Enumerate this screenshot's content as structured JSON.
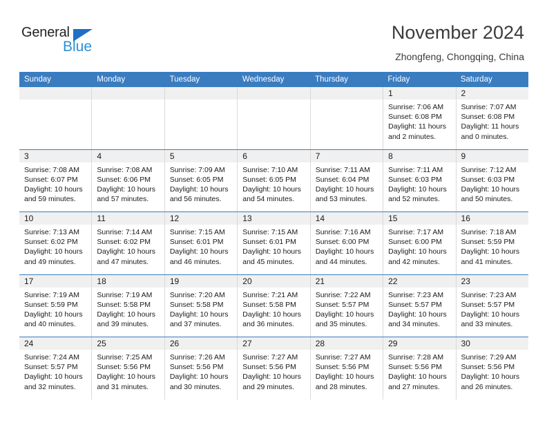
{
  "brand": {
    "name_part1": "General",
    "name_part2": "Blue",
    "accent_color": "#2d8ed6",
    "triangle_color": "#1f6fc4"
  },
  "header": {
    "title": "November 2024",
    "subtitle": "Zhongfeng, Chongqing, China"
  },
  "calendar": {
    "header_color": "#3a7cc0",
    "weekdays": [
      "Sunday",
      "Monday",
      "Tuesday",
      "Wednesday",
      "Thursday",
      "Friday",
      "Saturday"
    ],
    "weeks": [
      [
        {
          "date": "",
          "sunrise": "",
          "sunset": "",
          "daylight_line1": "",
          "daylight_line2": ""
        },
        {
          "date": "",
          "sunrise": "",
          "sunset": "",
          "daylight_line1": "",
          "daylight_line2": ""
        },
        {
          "date": "",
          "sunrise": "",
          "sunset": "",
          "daylight_line1": "",
          "daylight_line2": ""
        },
        {
          "date": "",
          "sunrise": "",
          "sunset": "",
          "daylight_line1": "",
          "daylight_line2": ""
        },
        {
          "date": "",
          "sunrise": "",
          "sunset": "",
          "daylight_line1": "",
          "daylight_line2": ""
        },
        {
          "date": "1",
          "sunrise": "Sunrise: 7:06 AM",
          "sunset": "Sunset: 6:08 PM",
          "daylight_line1": "Daylight: 11 hours",
          "daylight_line2": "and 2 minutes."
        },
        {
          "date": "2",
          "sunrise": "Sunrise: 7:07 AM",
          "sunset": "Sunset: 6:08 PM",
          "daylight_line1": "Daylight: 11 hours",
          "daylight_line2": "and 0 minutes."
        }
      ],
      [
        {
          "date": "3",
          "sunrise": "Sunrise: 7:08 AM",
          "sunset": "Sunset: 6:07 PM",
          "daylight_line1": "Daylight: 10 hours",
          "daylight_line2": "and 59 minutes."
        },
        {
          "date": "4",
          "sunrise": "Sunrise: 7:08 AM",
          "sunset": "Sunset: 6:06 PM",
          "daylight_line1": "Daylight: 10 hours",
          "daylight_line2": "and 57 minutes."
        },
        {
          "date": "5",
          "sunrise": "Sunrise: 7:09 AM",
          "sunset": "Sunset: 6:05 PM",
          "daylight_line1": "Daylight: 10 hours",
          "daylight_line2": "and 56 minutes."
        },
        {
          "date": "6",
          "sunrise": "Sunrise: 7:10 AM",
          "sunset": "Sunset: 6:05 PM",
          "daylight_line1": "Daylight: 10 hours",
          "daylight_line2": "and 54 minutes."
        },
        {
          "date": "7",
          "sunrise": "Sunrise: 7:11 AM",
          "sunset": "Sunset: 6:04 PM",
          "daylight_line1": "Daylight: 10 hours",
          "daylight_line2": "and 53 minutes."
        },
        {
          "date": "8",
          "sunrise": "Sunrise: 7:11 AM",
          "sunset": "Sunset: 6:03 PM",
          "daylight_line1": "Daylight: 10 hours",
          "daylight_line2": "and 52 minutes."
        },
        {
          "date": "9",
          "sunrise": "Sunrise: 7:12 AM",
          "sunset": "Sunset: 6:03 PM",
          "daylight_line1": "Daylight: 10 hours",
          "daylight_line2": "and 50 minutes."
        }
      ],
      [
        {
          "date": "10",
          "sunrise": "Sunrise: 7:13 AM",
          "sunset": "Sunset: 6:02 PM",
          "daylight_line1": "Daylight: 10 hours",
          "daylight_line2": "and 49 minutes."
        },
        {
          "date": "11",
          "sunrise": "Sunrise: 7:14 AM",
          "sunset": "Sunset: 6:02 PM",
          "daylight_line1": "Daylight: 10 hours",
          "daylight_line2": "and 47 minutes."
        },
        {
          "date": "12",
          "sunrise": "Sunrise: 7:15 AM",
          "sunset": "Sunset: 6:01 PM",
          "daylight_line1": "Daylight: 10 hours",
          "daylight_line2": "and 46 minutes."
        },
        {
          "date": "13",
          "sunrise": "Sunrise: 7:15 AM",
          "sunset": "Sunset: 6:01 PM",
          "daylight_line1": "Daylight: 10 hours",
          "daylight_line2": "and 45 minutes."
        },
        {
          "date": "14",
          "sunrise": "Sunrise: 7:16 AM",
          "sunset": "Sunset: 6:00 PM",
          "daylight_line1": "Daylight: 10 hours",
          "daylight_line2": "and 44 minutes."
        },
        {
          "date": "15",
          "sunrise": "Sunrise: 7:17 AM",
          "sunset": "Sunset: 6:00 PM",
          "daylight_line1": "Daylight: 10 hours",
          "daylight_line2": "and 42 minutes."
        },
        {
          "date": "16",
          "sunrise": "Sunrise: 7:18 AM",
          "sunset": "Sunset: 5:59 PM",
          "daylight_line1": "Daylight: 10 hours",
          "daylight_line2": "and 41 minutes."
        }
      ],
      [
        {
          "date": "17",
          "sunrise": "Sunrise: 7:19 AM",
          "sunset": "Sunset: 5:59 PM",
          "daylight_line1": "Daylight: 10 hours",
          "daylight_line2": "and 40 minutes."
        },
        {
          "date": "18",
          "sunrise": "Sunrise: 7:19 AM",
          "sunset": "Sunset: 5:58 PM",
          "daylight_line1": "Daylight: 10 hours",
          "daylight_line2": "and 39 minutes."
        },
        {
          "date": "19",
          "sunrise": "Sunrise: 7:20 AM",
          "sunset": "Sunset: 5:58 PM",
          "daylight_line1": "Daylight: 10 hours",
          "daylight_line2": "and 37 minutes."
        },
        {
          "date": "20",
          "sunrise": "Sunrise: 7:21 AM",
          "sunset": "Sunset: 5:58 PM",
          "daylight_line1": "Daylight: 10 hours",
          "daylight_line2": "and 36 minutes."
        },
        {
          "date": "21",
          "sunrise": "Sunrise: 7:22 AM",
          "sunset": "Sunset: 5:57 PM",
          "daylight_line1": "Daylight: 10 hours",
          "daylight_line2": "and 35 minutes."
        },
        {
          "date": "22",
          "sunrise": "Sunrise: 7:23 AM",
          "sunset": "Sunset: 5:57 PM",
          "daylight_line1": "Daylight: 10 hours",
          "daylight_line2": "and 34 minutes."
        },
        {
          "date": "23",
          "sunrise": "Sunrise: 7:23 AM",
          "sunset": "Sunset: 5:57 PM",
          "daylight_line1": "Daylight: 10 hours",
          "daylight_line2": "and 33 minutes."
        }
      ],
      [
        {
          "date": "24",
          "sunrise": "Sunrise: 7:24 AM",
          "sunset": "Sunset: 5:57 PM",
          "daylight_line1": "Daylight: 10 hours",
          "daylight_line2": "and 32 minutes."
        },
        {
          "date": "25",
          "sunrise": "Sunrise: 7:25 AM",
          "sunset": "Sunset: 5:56 PM",
          "daylight_line1": "Daylight: 10 hours",
          "daylight_line2": "and 31 minutes."
        },
        {
          "date": "26",
          "sunrise": "Sunrise: 7:26 AM",
          "sunset": "Sunset: 5:56 PM",
          "daylight_line1": "Daylight: 10 hours",
          "daylight_line2": "and 30 minutes."
        },
        {
          "date": "27",
          "sunrise": "Sunrise: 7:27 AM",
          "sunset": "Sunset: 5:56 PM",
          "daylight_line1": "Daylight: 10 hours",
          "daylight_line2": "and 29 minutes."
        },
        {
          "date": "28",
          "sunrise": "Sunrise: 7:27 AM",
          "sunset": "Sunset: 5:56 PM",
          "daylight_line1": "Daylight: 10 hours",
          "daylight_line2": "and 28 minutes."
        },
        {
          "date": "29",
          "sunrise": "Sunrise: 7:28 AM",
          "sunset": "Sunset: 5:56 PM",
          "daylight_line1": "Daylight: 10 hours",
          "daylight_line2": "and 27 minutes."
        },
        {
          "date": "30",
          "sunrise": "Sunrise: 7:29 AM",
          "sunset": "Sunset: 5:56 PM",
          "daylight_line1": "Daylight: 10 hours",
          "daylight_line2": "and 26 minutes."
        }
      ]
    ]
  }
}
